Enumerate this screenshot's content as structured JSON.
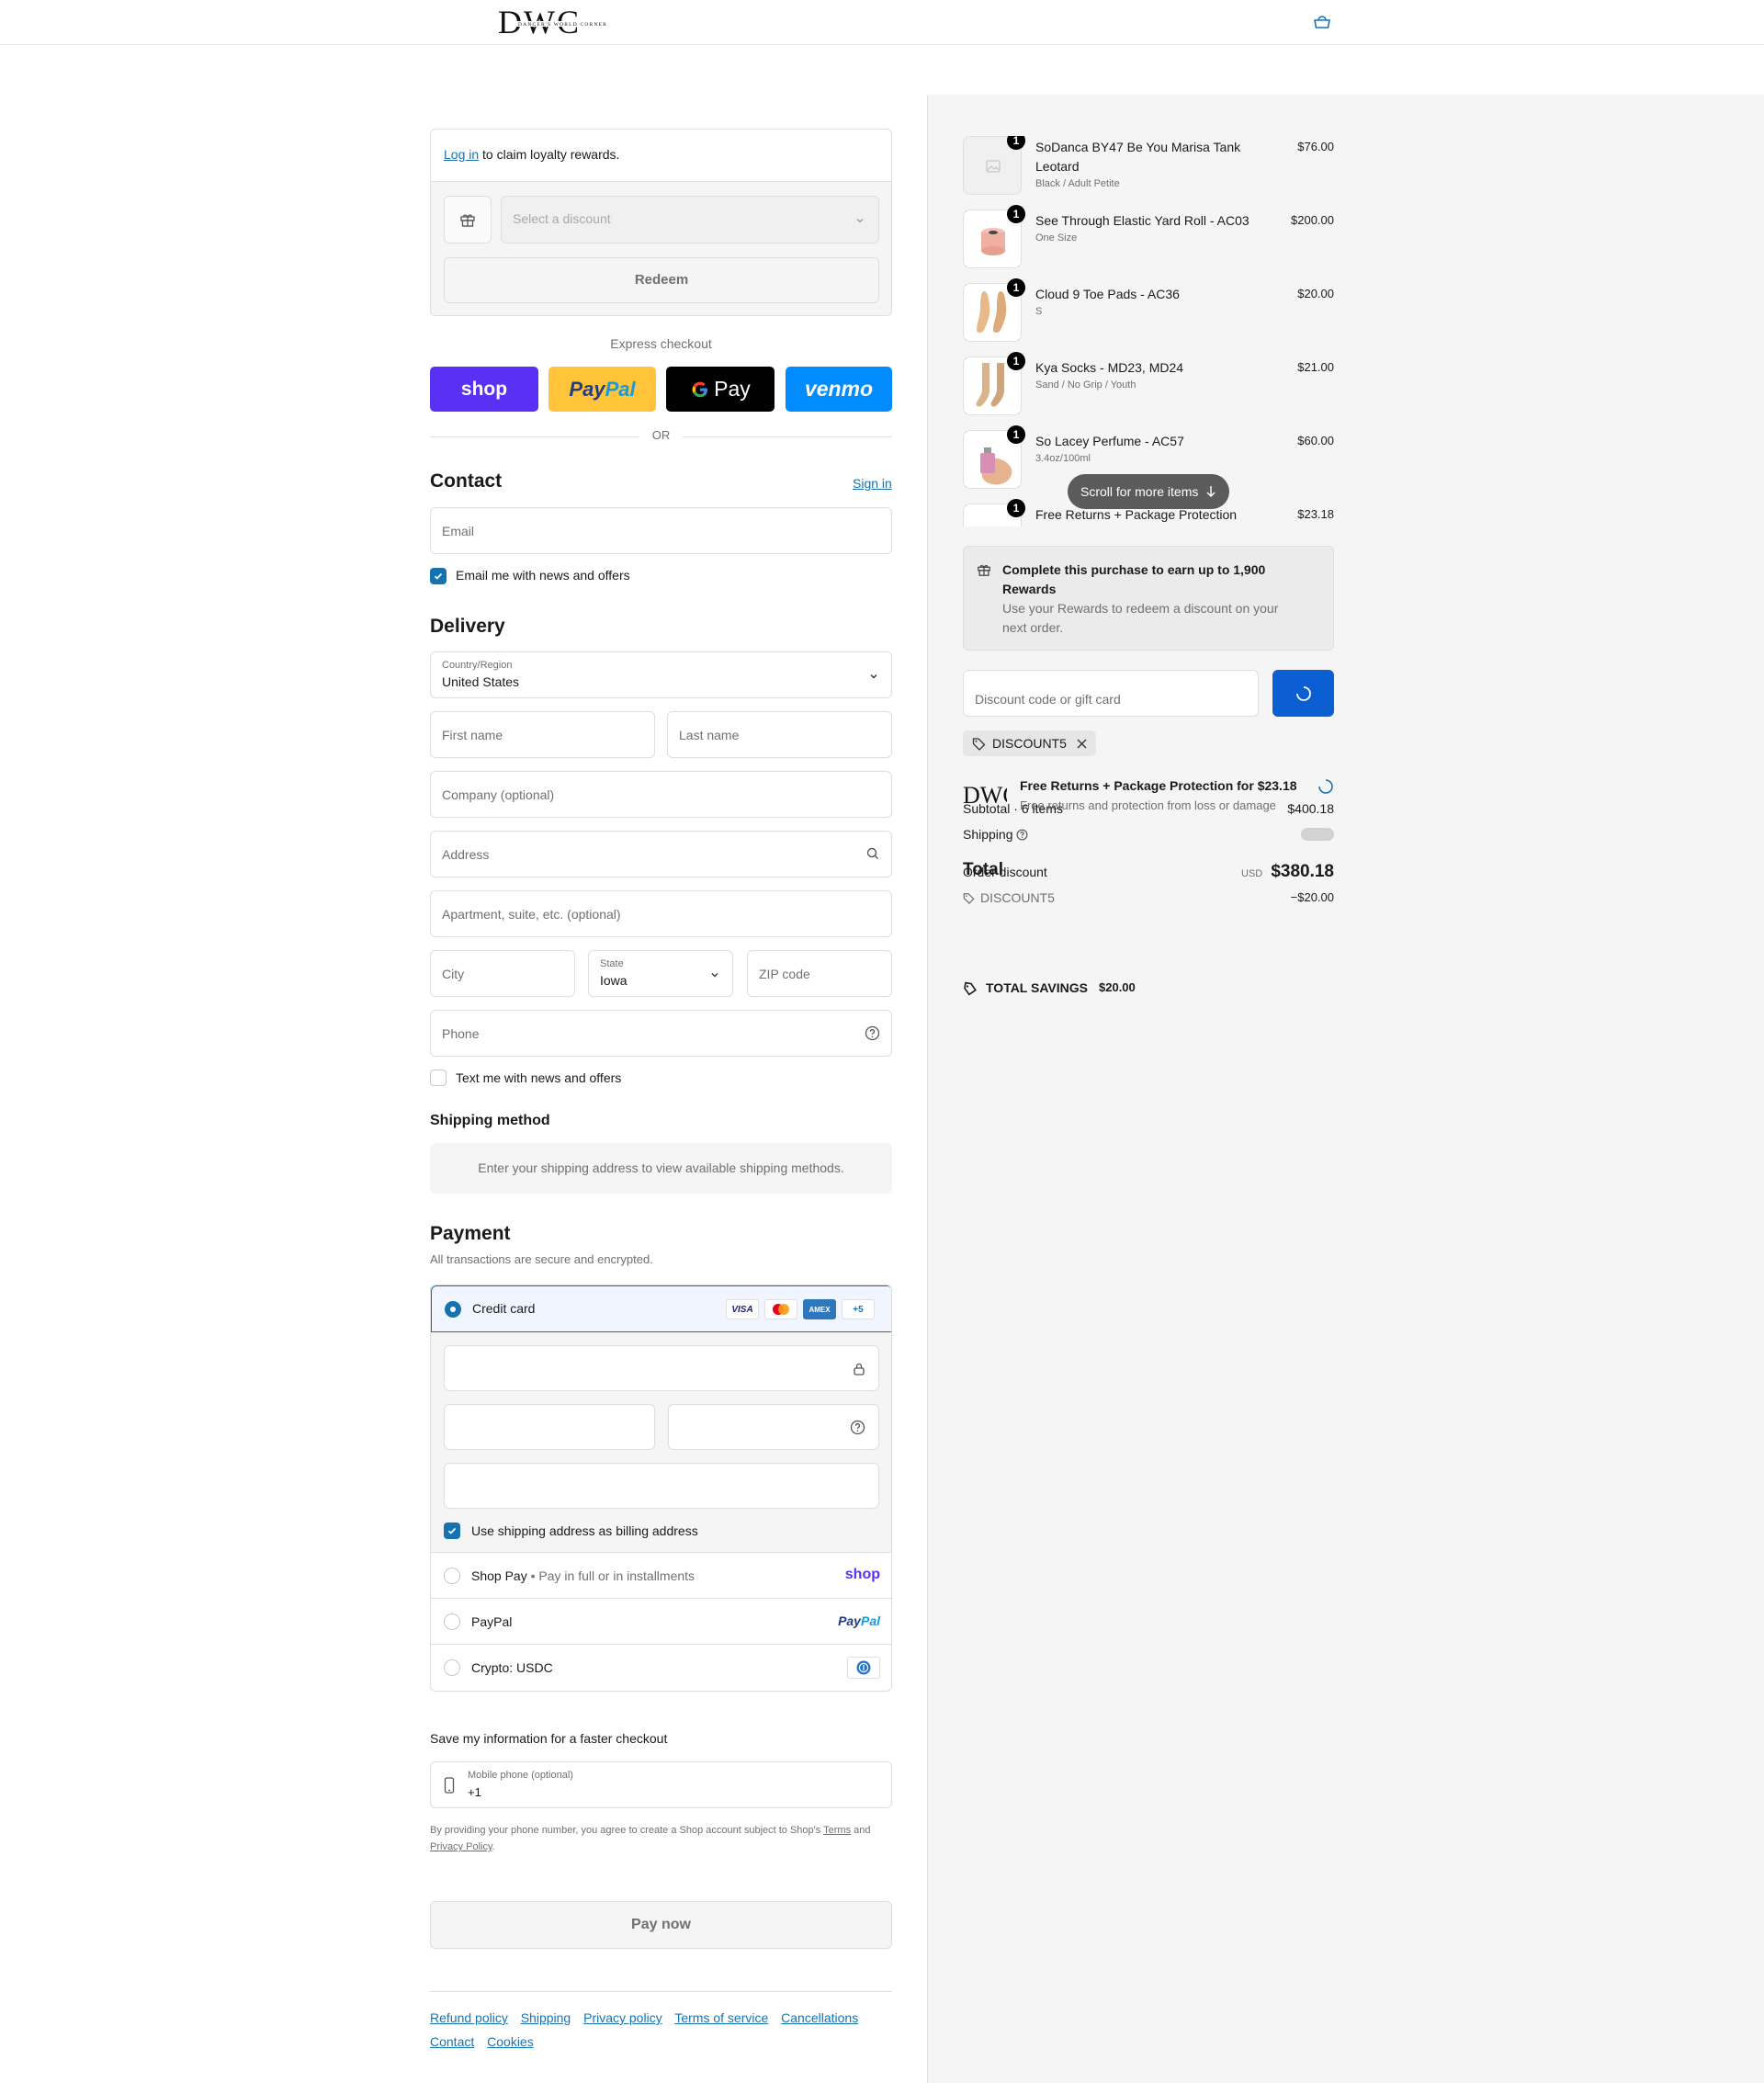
{
  "header": {
    "logo_text": "DWC",
    "logo_sub": "DANCER'S WORLD CORNER"
  },
  "loyalty": {
    "login_link": "Log in",
    "login_rest": " to claim loyalty rewards.",
    "select_placeholder": "Select a discount",
    "redeem_label": "Redeem"
  },
  "express": {
    "label": "Express checkout",
    "shop": "shop",
    "paypal_pay": "Pay",
    "paypal_pal": "Pal",
    "gpay": "Pay",
    "venmo": "venmo",
    "or": "OR"
  },
  "contact": {
    "title": "Contact",
    "signin": "Sign in",
    "email_placeholder": "Email",
    "news_label": "Email me with news and offers"
  },
  "delivery": {
    "title": "Delivery",
    "country_label": "Country/Region",
    "country_value": "United States",
    "first_name": "First name",
    "last_name": "Last name",
    "company": "Company (optional)",
    "address": "Address",
    "apartment": "Apartment, suite, etc. (optional)",
    "city": "City",
    "state_label": "State",
    "state_value": "Iowa",
    "zip": "ZIP code",
    "phone": "Phone",
    "text_label": "Text me with news and offers"
  },
  "shipping_method": {
    "title": "Shipping method",
    "message": "Enter your shipping address to view available shipping methods."
  },
  "payment": {
    "title": "Payment",
    "subtitle": "All transactions are secure and encrypted.",
    "credit_card": "Credit card",
    "badges": {
      "visa": "VISA",
      "amex": "AMEX",
      "more": "+5"
    },
    "billing_label": "Use shipping address as billing address",
    "shop_pay": "Shop Pay",
    "shop_pay_sub": "Pay in full or in installments",
    "shop_pay_logo": "shop",
    "paypal": "PayPal",
    "paypal_logo_pay": "Pay",
    "paypal_logo_pal": "Pal",
    "crypto": "Crypto: USDC"
  },
  "save": {
    "title": "Save my information for a faster checkout",
    "mobile_label": "Mobile phone (optional)",
    "mobile_value": "+1",
    "legal_1": "By providing your phone number, you agree to create a Shop account subject to Shop's ",
    "terms": "Terms",
    "legal_and": " and ",
    "privacy": "Privacy Policy",
    "legal_end": "."
  },
  "pay_now": "Pay now",
  "footer": {
    "links": [
      "Refund policy",
      "Shipping",
      "Privacy policy",
      "Terms of service",
      "Cancellations",
      "Contact",
      "Cookies"
    ]
  },
  "summary": {
    "items": [
      {
        "name": "SoDanca BY47 Be You Marisa Tank Leotard",
        "variant": "Black / Adult Petite",
        "price": "$76.00",
        "qty": "1"
      },
      {
        "name": "See Through Elastic Yard Roll - AC03",
        "variant": "One Size",
        "price": "$200.00",
        "qty": "1"
      },
      {
        "name": "Cloud 9 Toe Pads - AC36",
        "variant": "S",
        "price": "$20.00",
        "qty": "1"
      },
      {
        "name": "Kya Socks - MD23, MD24",
        "variant": "Sand / No Grip / Youth",
        "price": "$21.00",
        "qty": "1"
      },
      {
        "name": "So Lacey Perfume - AC57",
        "variant": "3.4oz/100ml",
        "price": "$60.00",
        "qty": "1"
      },
      {
        "name": "Free Returns + Package Protection",
        "variant": "",
        "price": "$23.18",
        "qty": "1"
      }
    ],
    "scroll_pill": "Scroll for more items",
    "rewards_title": "Complete this purchase to earn up to 1,900 Rewards",
    "rewards_sub": "Use your Rewards to redeem a discount on your next order.",
    "code_placeholder": "Discount code or gift card",
    "applied_code": "DISCOUNT5",
    "protection_title": "Free Returns + Package Protection for $23.18",
    "protection_sub": "Free returns and protection from loss or damage",
    "subtotal_label": "Subtotal · 6 items",
    "subtotal_value": "$400.18",
    "shipping_label": "Shipping",
    "order_discount_label": "Order discount",
    "discount_code": "DISCOUNT5",
    "discount_value": "−$20.00",
    "total_label": "Total",
    "currency": "USD",
    "total_value": "$380.18",
    "savings_label": "TOTAL SAVINGS",
    "savings_value": "$20.00"
  }
}
